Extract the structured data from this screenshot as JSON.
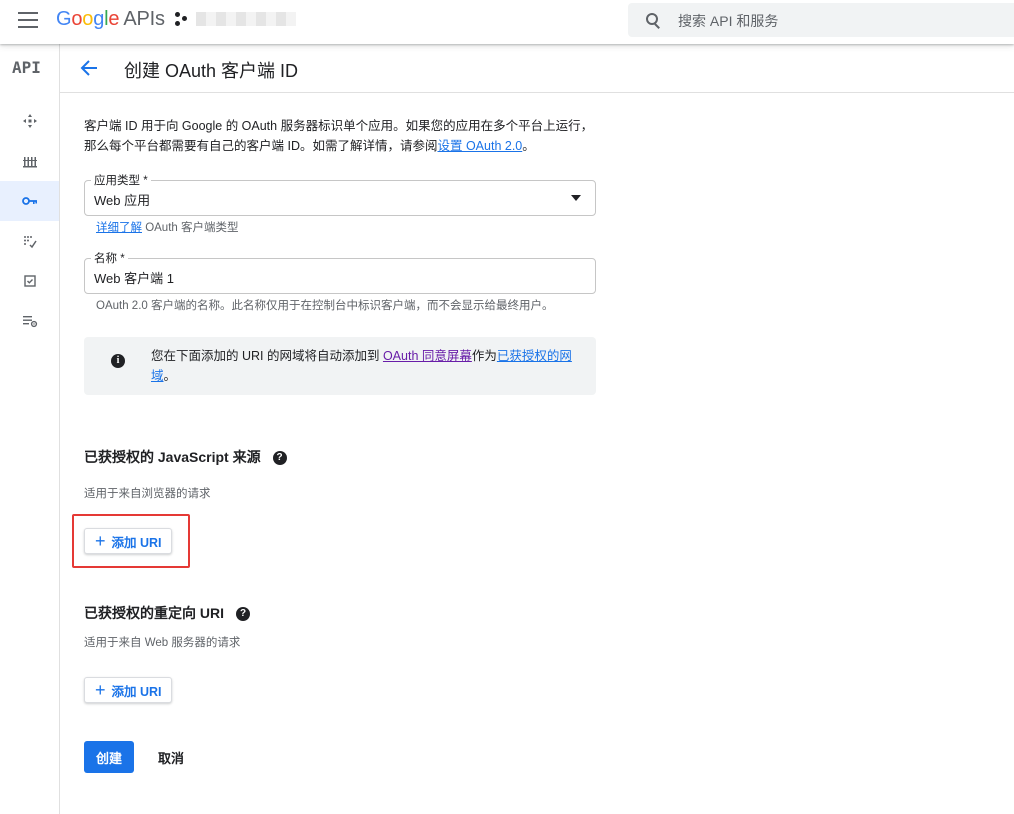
{
  "topbar": {
    "logo_letters": [
      "G",
      "o",
      "o",
      "g",
      "l",
      "e"
    ],
    "logo_suffix": "APIs",
    "search_placeholder": "搜索 API 和服务"
  },
  "rail": {
    "api_label": "API",
    "items": [
      {
        "name": "dashboard",
        "icon": "move-icon"
      },
      {
        "name": "library",
        "icon": "library-icon"
      },
      {
        "name": "credentials",
        "icon": "key-icon",
        "active": true
      },
      {
        "name": "oauth-consent",
        "icon": "consent-icon"
      },
      {
        "name": "domain-verification",
        "icon": "checkbox-icon"
      },
      {
        "name": "settings",
        "icon": "settings-list-icon"
      }
    ]
  },
  "header": {
    "title": "创建 OAuth 客户端 ID"
  },
  "description": {
    "text": "客户端 ID 用于向 Google 的 OAuth 服务器标识单个应用。如果您的应用在多个平台上运行，那么每个平台都需要有自己的客户端 ID。如需了解详情，请参阅",
    "link": "设置 OAuth 2.0",
    "suffix": "。"
  },
  "app_type": {
    "label": "应用类型 *",
    "value": "Web 应用",
    "hint_link": "详细了解",
    "hint_text": " OAuth 客户端类型"
  },
  "name_field": {
    "label": "名称 *",
    "value": "Web 客户端 1",
    "hint": "OAuth 2.0 客户端的名称。此名称仅用于在控制台中标识客户端，而不会显示给最终用户。"
  },
  "info_box": {
    "text1": "您在下面添加的 URI 的网域将自动添加到 ",
    "link1": "OAuth 同意屏幕",
    "text2": "作为",
    "link2": "已获授权的网域",
    "text3": "。"
  },
  "js_origins": {
    "title": "已获授权的 JavaScript 来源",
    "subtitle": "适用于来自浏览器的请求",
    "add_button": "添加 URI"
  },
  "redirect_uris": {
    "title": "已获授权的重定向 URI",
    "subtitle": "适用于来自 Web 服务器的请求",
    "add_button": "添加 URI"
  },
  "actions": {
    "create": "创建",
    "cancel": "取消"
  },
  "colors": {
    "primary": "#1a73e8",
    "visited_link": "#681da8",
    "highlight": "#e53935",
    "active_rail": "#e8f0fe"
  }
}
